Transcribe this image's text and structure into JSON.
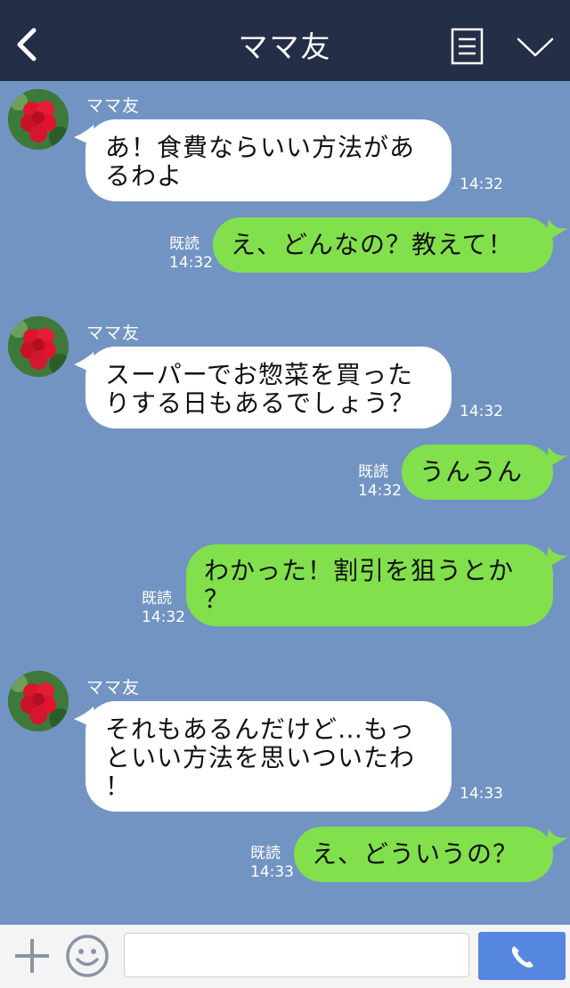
{
  "header": {
    "title": "ママ友",
    "back_icon": "chevron-left-icon",
    "menu_icon": "notes-icon",
    "collapse_icon": "chevron-down-icon"
  },
  "messages": [
    {
      "side": "left",
      "sender": "ママ友",
      "text": "あ！食費ならいい方法があるわよ",
      "lines": [
        "あ！食費ならいい方法があ",
        "るわよ"
      ],
      "time": "14:32"
    },
    {
      "side": "right",
      "text": "え、どんなの？教えて！",
      "read": "既読",
      "time": "14:32"
    },
    {
      "side": "left",
      "sender": "ママ友",
      "text": "スーパーでお惣菜を買ったりする日もあるでしょう？",
      "lines": [
        "スーパーでお惣菜を買った",
        "りする日もあるでしょう？"
      ],
      "time": "14:32"
    },
    {
      "side": "right",
      "text": "うんうん",
      "read": "既読",
      "time": "14:32"
    },
    {
      "side": "right",
      "text": "わかった！割引を狙うとか？",
      "lines": [
        "わかった！割引を狙うとか",
        "？"
      ],
      "read": "既読",
      "time": "14:32"
    },
    {
      "side": "left",
      "sender": "ママ友",
      "text": "それもあるんだけど…もっといい方法を思いついたわ！",
      "lines": [
        "それもあるんだけど…もっ",
        "といい方法を思いついたわ",
        "！"
      ],
      "time": "14:33"
    },
    {
      "side": "right",
      "text": "え、どういうの？",
      "read": "既読",
      "time": "14:33"
    }
  ],
  "input_bar": {
    "plus_icon": "plus-icon",
    "emoji_icon": "smiley-icon",
    "message_value": "",
    "call_icon": "phone-icon"
  },
  "colors": {
    "header_bg": "#242e47",
    "chat_bg": "#7294c3",
    "sent_bubble": "#82e04d",
    "received_bubble": "#ffffff",
    "call_button": "#5587e0"
  }
}
